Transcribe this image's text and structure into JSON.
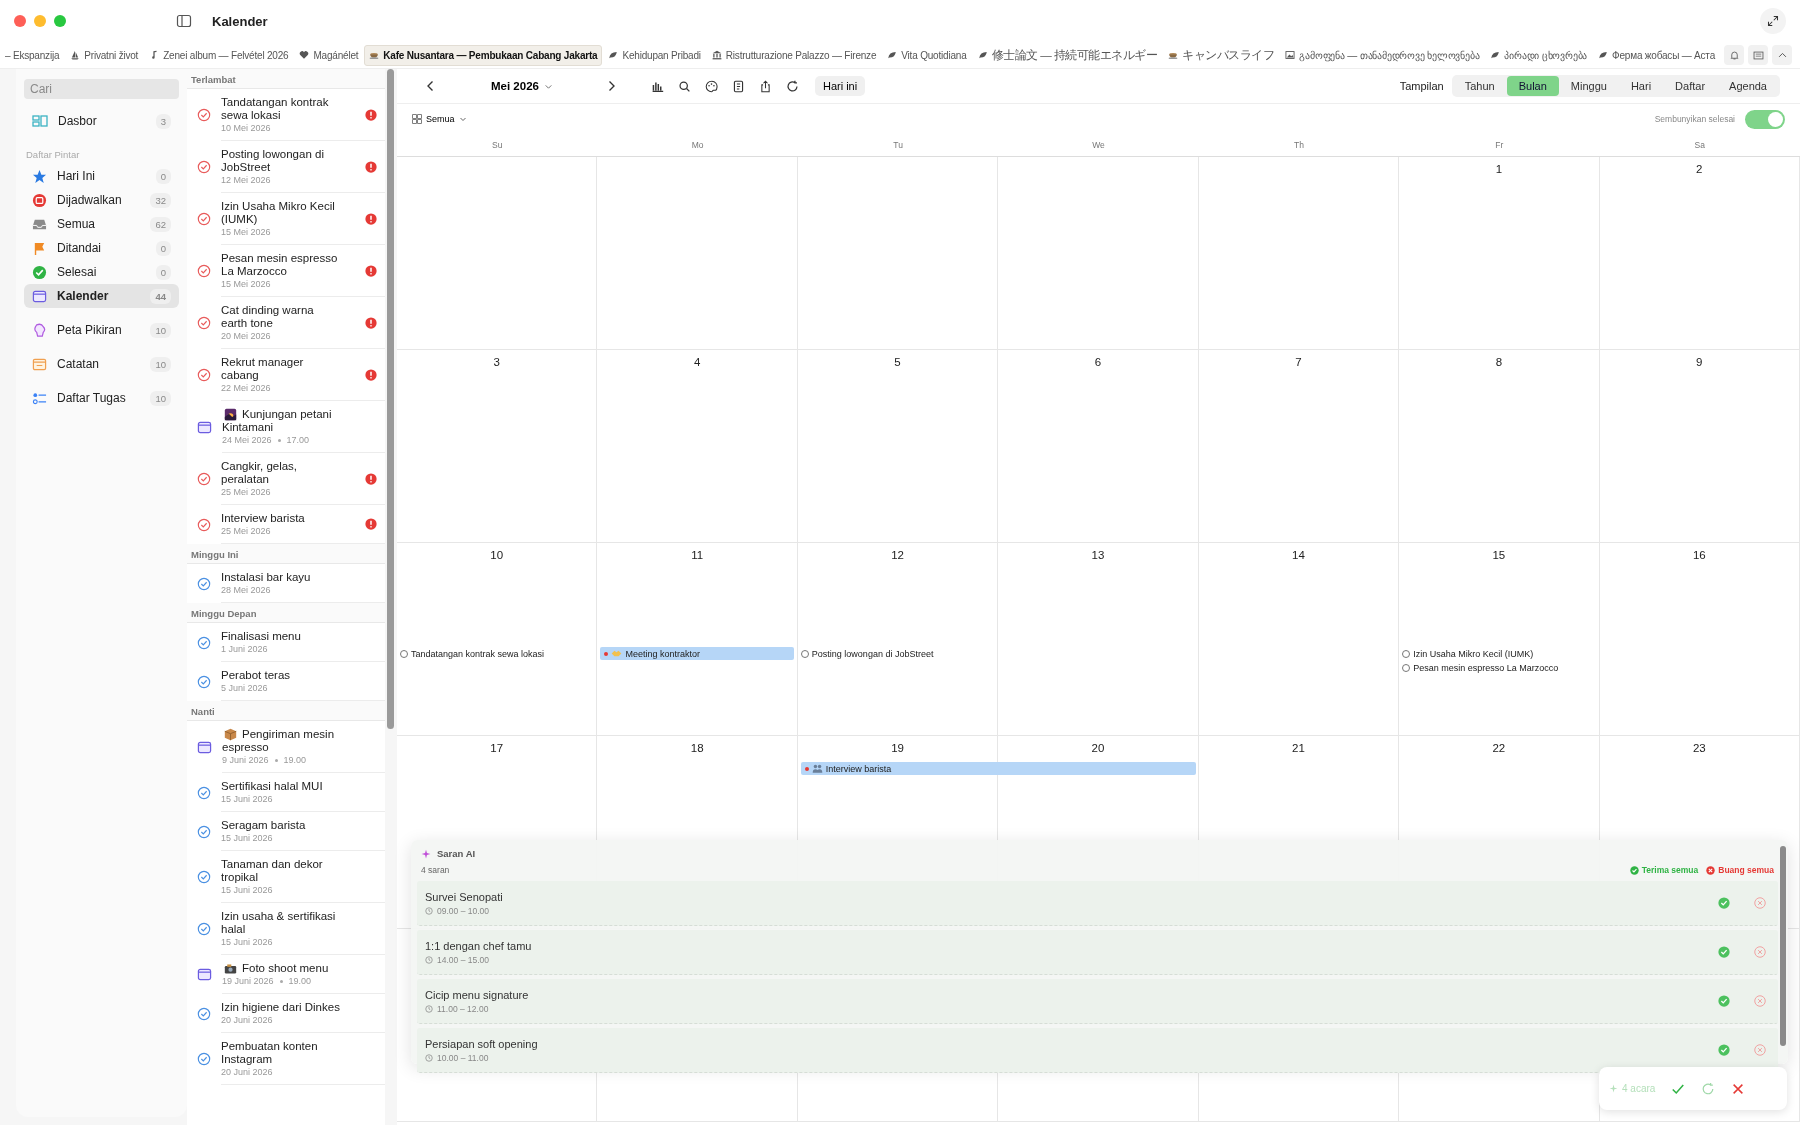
{
  "window": {
    "title": "Kalender"
  },
  "tabs": [
    {
      "label": "– Ekspanzija",
      "selected": false
    },
    {
      "label": "Privatni život",
      "selected": false
    },
    {
      "label": "Zenei album — Felvétel 2026",
      "selected": false
    },
    {
      "label": "Magánélet",
      "selected": false
    },
    {
      "label": "Kafe Nusantara — Pembukaan Cabang Jakarta",
      "selected": true
    },
    {
      "label": "Kehidupan Pribadi",
      "selected": false
    },
    {
      "label": "Ristrutturazione Palazzo — Firenze",
      "selected": false
    },
    {
      "label": "Vita Quotidiana",
      "selected": false
    },
    {
      "label": "修士論文 — 持続可能エネルギー",
      "selected": false
    },
    {
      "label": "キャンバスライフ",
      "selected": false
    },
    {
      "label": "გამოფენა — თანამედროვე ხელოვნება",
      "selected": false
    },
    {
      "label": "პირადი ცხოვრება",
      "selected": false
    },
    {
      "label": "Ферма жобасы — Аста",
      "selected": false
    }
  ],
  "sidebar": {
    "search": {
      "placeholder": "Cari"
    },
    "top_items": [
      {
        "label": "Dasbor",
        "count": "3",
        "selected": false
      }
    ],
    "smart_lists": {
      "title": "Daftar Pintar",
      "items": [
        {
          "label": "Hari Ini",
          "count": "0",
          "selected": false
        },
        {
          "label": "Dijadwalkan",
          "count": "32",
          "selected": false
        },
        {
          "label": "Semua",
          "count": "62",
          "selected": false
        },
        {
          "label": "Ditandai",
          "count": "0",
          "selected": false
        },
        {
          "label": "Selesai",
          "count": "0",
          "selected": false
        },
        {
          "label": "Kalender",
          "count": "44",
          "selected": true
        }
      ]
    },
    "other_items": [
      {
        "label": "Peta Pikiran",
        "count": "10",
        "selected": false
      },
      {
        "label": "Catatan",
        "count": "10",
        "selected": false
      },
      {
        "label": "Daftar Tugas",
        "count": "10",
        "selected": false
      }
    ]
  },
  "task_sections": [
    {
      "title": "Terlambat",
      "items": [
        {
          "title": "Tandatangan kontrak sewa lokasi",
          "date": "10 Mei 2026",
          "kind": "task",
          "overdue": true
        },
        {
          "title": "Posting lowongan di JobStreet",
          "date": "12 Mei 2026",
          "kind": "task",
          "overdue": true
        },
        {
          "title": "Izin Usaha Mikro Kecil (IUMK)",
          "date": "15 Mei 2026",
          "kind": "task",
          "overdue": true
        },
        {
          "title": "Pesan mesin espresso La Marzocco",
          "date": "15 Mei 2026",
          "kind": "task",
          "overdue": true
        },
        {
          "title": "Cat dinding warna earth tone",
          "date": "20 Mei 2026",
          "kind": "task",
          "overdue": true
        },
        {
          "title": "Rekrut manager cabang",
          "date": "22 Mei 2026",
          "kind": "task",
          "overdue": true
        },
        {
          "title": "Kunjungan petani Kintamani",
          "date": "24 Mei 2026",
          "time": "17.00",
          "kind": "event"
        },
        {
          "title": "Cangkir, gelas, peralatan",
          "date": "25 Mei 2026",
          "kind": "task",
          "overdue": true
        },
        {
          "title": "Interview barista",
          "date": "25 Mei 2026",
          "kind": "task",
          "overdue": true
        }
      ]
    },
    {
      "title": "Minggu Ini",
      "items": [
        {
          "title": "Instalasi bar kayu",
          "date": "28 Mei 2026",
          "kind": "task",
          "overdue": false
        }
      ]
    },
    {
      "title": "Minggu Depan",
      "items": [
        {
          "title": "Finalisasi menu",
          "date": "1 Juni 2026",
          "kind": "task",
          "overdue": false
        },
        {
          "title": "Perabot teras",
          "date": "5 Juni 2026",
          "kind": "task",
          "overdue": false
        }
      ]
    },
    {
      "title": "Nanti",
      "items": [
        {
          "title": "Pengiriman mesin espresso",
          "date": "9 Juni 2026",
          "time": "19.00",
          "kind": "event"
        },
        {
          "title": "Sertifikasi halal MUI",
          "date": "15 Juni 2026",
          "kind": "task",
          "overdue": false
        },
        {
          "title": "Seragam barista",
          "date": "15 Juni 2026",
          "kind": "task",
          "overdue": false
        },
        {
          "title": "Tanaman dan dekor tropikal",
          "date": "15 Juni 2026",
          "kind": "task",
          "overdue": false
        },
        {
          "title": "Izin usaha & sertifikasi halal",
          "date": "15 Juni 2026",
          "kind": "task",
          "overdue": false
        },
        {
          "title": "Foto shoot menu",
          "date": "19 Juni 2026",
          "time": "19.00",
          "kind": "event"
        },
        {
          "title": "Izin higiene dari Dinkes",
          "date": "20 Juni 2026",
          "kind": "task",
          "overdue": false
        },
        {
          "title": "Pembuatan konten Instagram",
          "date": "20 Juni 2026",
          "kind": "task",
          "overdue": false
        }
      ]
    }
  ],
  "calendar": {
    "month": "Mei 2026",
    "today_button": "Hari ini",
    "view_label": "Tampilan",
    "views": [
      {
        "label": "Tahun",
        "selected": false
      },
      {
        "label": "Bulan",
        "selected": true
      },
      {
        "label": "Minggu",
        "selected": false
      },
      {
        "label": "Hari",
        "selected": false
      },
      {
        "label": "Daftar",
        "selected": false
      },
      {
        "label": "Agenda",
        "selected": false
      }
    ],
    "filter": "Semua",
    "hide_done": {
      "label": "Sembunyikan selesai",
      "on": true
    },
    "weekdays": [
      "Su",
      "Mo",
      "Tu",
      "We",
      "Th",
      "Fr",
      "Sa"
    ],
    "weeks": [
      {
        "cells": [
          {},
          {},
          {},
          {},
          {},
          {
            "day": "1"
          },
          {
            "day": "2"
          }
        ]
      },
      {
        "cells": [
          {
            "day": "3"
          },
          {
            "day": "4"
          },
          {
            "day": "5"
          },
          {
            "day": "6"
          },
          {
            "day": "7"
          },
          {
            "day": "8"
          },
          {
            "day": "9"
          }
        ]
      },
      {
        "cells": [
          {
            "day": "10",
            "events": [
              {
                "title": "Tandatangan kontrak sewa lokasi",
                "kind": "task"
              }
            ]
          },
          {
            "day": "11",
            "events": [
              {
                "title": "Meeting kontraktor",
                "kind": "event"
              }
            ]
          },
          {
            "day": "12",
            "events": [
              {
                "title": "Posting lowongan di JobStreet",
                "kind": "task"
              }
            ]
          },
          {
            "day": "13"
          },
          {
            "day": "14"
          },
          {
            "day": "15",
            "events": [
              {
                "title": "Izin Usaha Mikro Kecil (IUMK)",
                "kind": "task"
              },
              {
                "title": "Pesan mesin espresso La Marzocco",
                "kind": "task"
              }
            ]
          },
          {
            "day": "16"
          }
        ]
      },
      {
        "cells": [
          {
            "day": "17"
          },
          {
            "day": "18"
          },
          {
            "day": "19",
            "events": [
              {
                "title": "Interview barista",
                "kind": "event",
                "spans_next": true
              }
            ]
          },
          {
            "day": "20"
          },
          {
            "day": "21"
          },
          {
            "day": "22"
          },
          {
            "day": "23"
          }
        ]
      }
    ]
  },
  "ai_panel": {
    "title": "Saran AI",
    "count": "4 saran",
    "accept_all": "Terima semua",
    "discard_all": "Buang semua",
    "suggestions": [
      {
        "title": "Survei Senopati",
        "time": "09.00 – 10.00"
      },
      {
        "title": "1:1 dengan chef tamu",
        "time": "14.00 – 15.00"
      },
      {
        "title": "Cicip menu signature",
        "time": "11.00 – 12.00"
      },
      {
        "title": "Persiapan soft opening",
        "time": "10.00 – 11.00"
      }
    ]
  },
  "floating_bar": {
    "count": "4 acara"
  }
}
